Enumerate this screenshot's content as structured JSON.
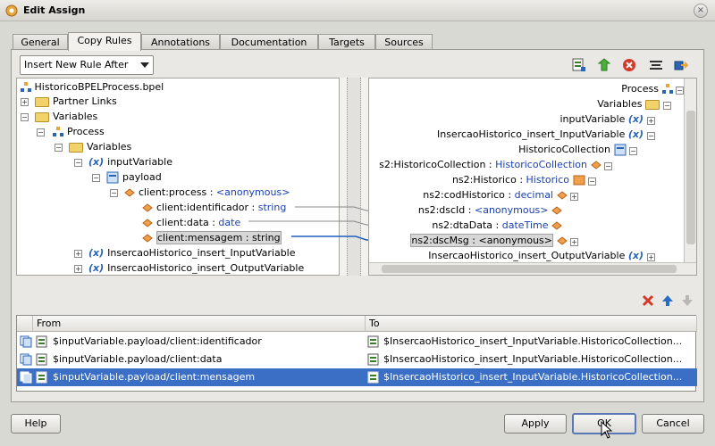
{
  "window": {
    "title": "Edit Assign"
  },
  "tabs": [
    {
      "label": "General"
    },
    {
      "label": "Copy Rules"
    },
    {
      "label": "Annotations"
    },
    {
      "label": "Documentation"
    },
    {
      "label": "Targets"
    },
    {
      "label": "Sources"
    }
  ],
  "toolbar": {
    "rule_mode": "Insert New Rule After"
  },
  "source_tree": {
    "root": "HistoricoBPELProcess.bpel",
    "partner_links": "Partner Links",
    "variables": "Variables",
    "process": "Process",
    "variables2": "Variables",
    "input_variable": "inputVariable",
    "payload": "payload",
    "client_process": "client:process",
    "client_process_type": "<anonymous>",
    "identificador": "client:identificador",
    "identificador_type": "string",
    "data": "client:data",
    "data_type": "date",
    "mensagem": "client:mensagem",
    "mensagem_type": "string",
    "insert_input": "InsercaoHistorico_insert_InputVariable",
    "insert_output": "InsercaoHistorico_insert_OutputVariable"
  },
  "target_tree": {
    "process": "Process",
    "variables": "Variables",
    "input_variable": "inputVariable",
    "insert_input": "InsercaoHistorico_insert_InputVariable",
    "collection": "HistoricoCollection",
    "ns2_collection": "s2:HistoricoCollection",
    "ns2_collection_type": "HistoricoCollection",
    "ns2_historico": "ns2:Historico",
    "ns2_historico_type": "Historico",
    "cod_historico": "ns2:codHistorico",
    "cod_historico_type": "decimal",
    "dsc_id": "ns2:dscId",
    "dsc_id_type": "<anonymous>",
    "dta_data": "ns2:dtaData",
    "dta_data_type": "dateTime",
    "dsc_msg": "ns2:dscMsg : <anonymous>",
    "insert_output": "InsercaoHistorico_insert_OutputVariable"
  },
  "type_separator": " : ",
  "rules_table": {
    "headers": {
      "from": "From",
      "to": "To"
    },
    "rows": [
      {
        "from": "$inputVariable.payload/client:identificador",
        "to": "$InsercaoHistorico_insert_InputVariable.HistoricoCollection..."
      },
      {
        "from": "$inputVariable.payload/client:data",
        "to": "$InsercaoHistorico_insert_InputVariable.HistoricoCollection..."
      },
      {
        "from": "$inputVariable.payload/client:mensagem",
        "to": "$InsercaoHistorico_insert_InputVariable.HistoricoCollection..."
      }
    ]
  },
  "buttons": {
    "help": "Help",
    "apply": "Apply",
    "ok": "OK",
    "cancel": "Cancel"
  },
  "colors": {
    "selection": "#3b6fc5",
    "type_text": "#1a3fb0",
    "delete": "#d43a2a",
    "arrow": "#2a6cc4"
  }
}
